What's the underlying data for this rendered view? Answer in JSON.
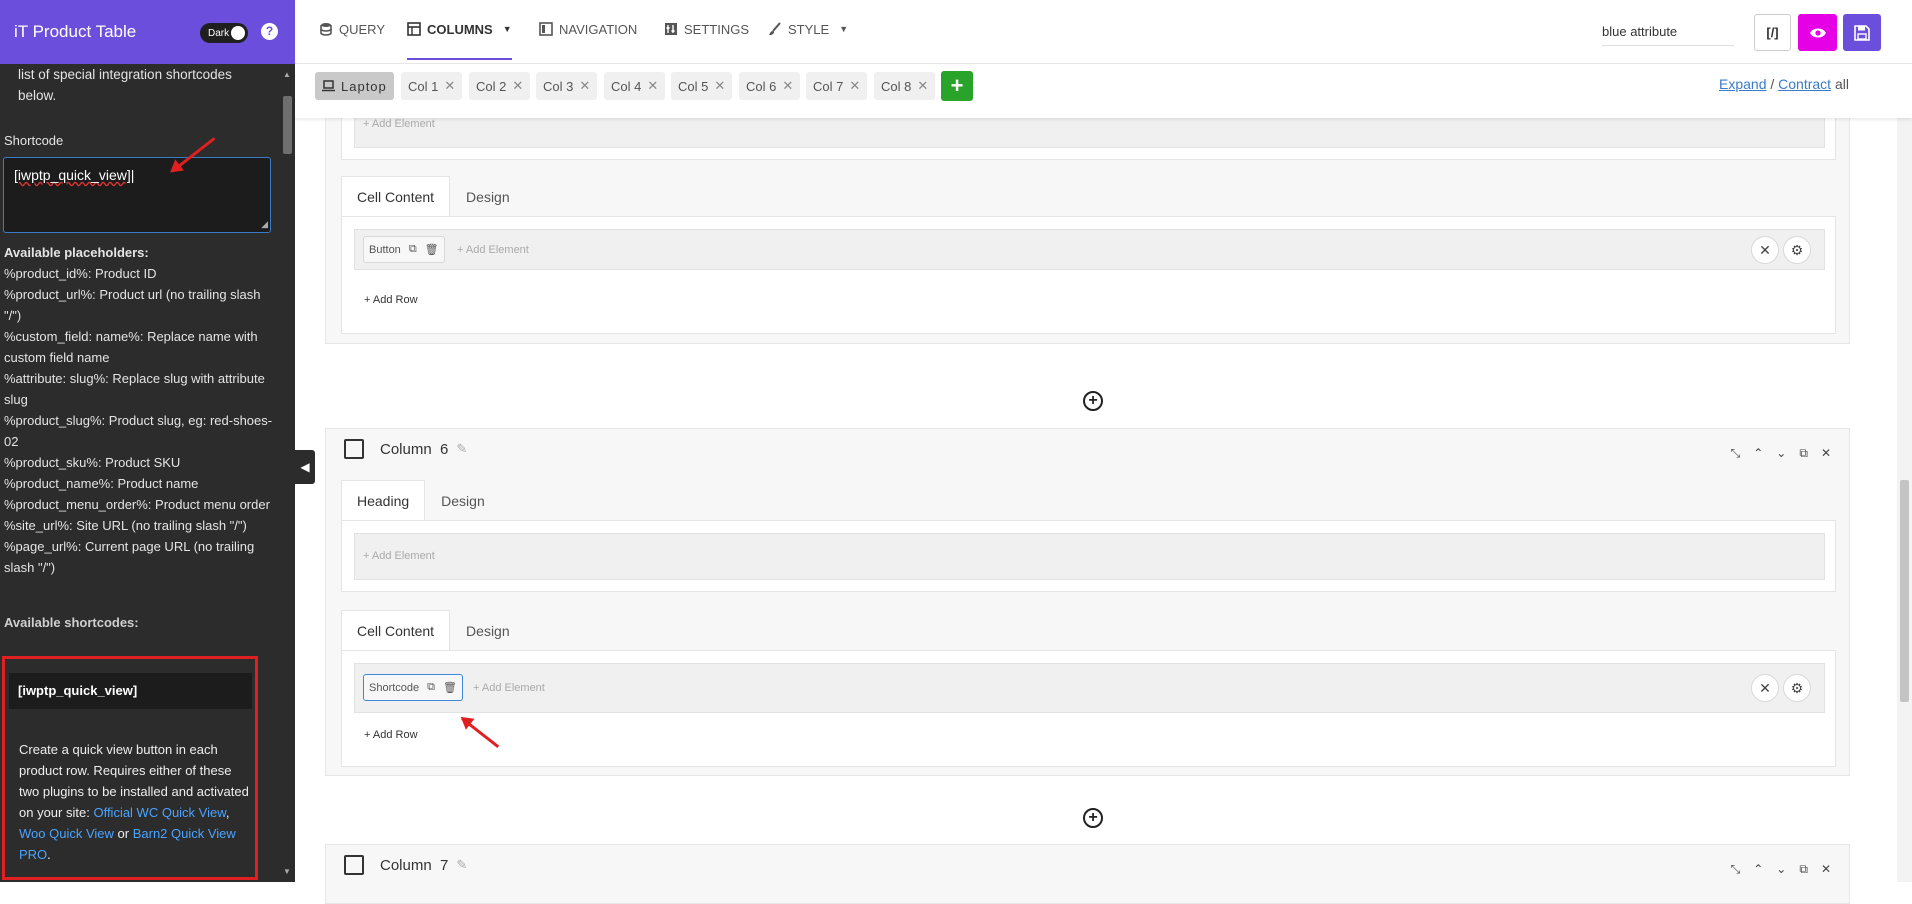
{
  "sidebar": {
    "title": "iT Product Table",
    "dark_label": "Dark",
    "help": "?",
    "intro": "list of special integration shortcodes below.",
    "shortcode_label": "Shortcode",
    "shortcode_value": "[iwptp_quick_view]",
    "placeholders_title": "Available placeholders:",
    "placeholders": [
      "%product_id%: Product ID",
      "%product_url%: Product url (no trailing slash \"/\")",
      "%custom_field: name%: Replace name with custom field name",
      "%attribute: slug%: Replace slug with attribute slug",
      "%product_slug%: Product slug, eg: red-shoes-02",
      "%product_sku%: Product SKU",
      "%product_name%: Product name",
      "%product_menu_order%: Product menu order",
      "%site_url%: Site URL (no trailing slash \"/\")",
      "%page_url%: Current page URL (no trailing slash \"/\")"
    ],
    "shortcodes_title": "Available shortcodes:",
    "shortcode_box": {
      "name": "[iwptp_quick_view]",
      "desc_before": "Create a quick view button in each product row. Requires either of these two plugins to be installed and activated on your site:",
      "link1": "Official WC Quick View",
      "sep1": ",",
      "link2": "Woo Quick View",
      "sep2": "or",
      "link3": "Barn2 Quick View PRO",
      "end": "."
    }
  },
  "nav": {
    "tabs": [
      {
        "label": "QUERY",
        "icon": "database-icon"
      },
      {
        "label": "COLUMNS",
        "icon": "table-icon",
        "active": true,
        "caret": "▼"
      },
      {
        "label": "NAVIGATION",
        "icon": "navigation-icon"
      },
      {
        "label": "SETTINGS",
        "icon": "settings-icon"
      },
      {
        "label": "STYLE",
        "icon": "brush-icon",
        "caret": "▼"
      }
    ],
    "search_value": "blue attribute",
    "code_label": "[/]"
  },
  "subnav": {
    "device": "Laptop",
    "columns": [
      "Col 1",
      "Col 2",
      "Col 3",
      "Col 4",
      "Col 5",
      "Col 6",
      "Col 7",
      "Col 8"
    ],
    "add_label": "+",
    "expand": "Expand",
    "slash": "/",
    "contract": "Contract",
    "all": "all"
  },
  "content": {
    "add_element": "+ Add Element",
    "add_row": "+ Add Row",
    "tab_cell_content": "Cell Content",
    "tab_design": "Design",
    "tab_heading": "Heading",
    "col5_element": "Button",
    "column6_title": "Column",
    "column6_number": "6",
    "col6_element": "Shortcode",
    "column7_title": "Column",
    "column7_number": "7"
  },
  "colors": {
    "brand": "#6b4fdc",
    "preview": "#e600e6",
    "add": "#29a329",
    "highlight": "#e02020",
    "link": "#3a7bc8"
  }
}
